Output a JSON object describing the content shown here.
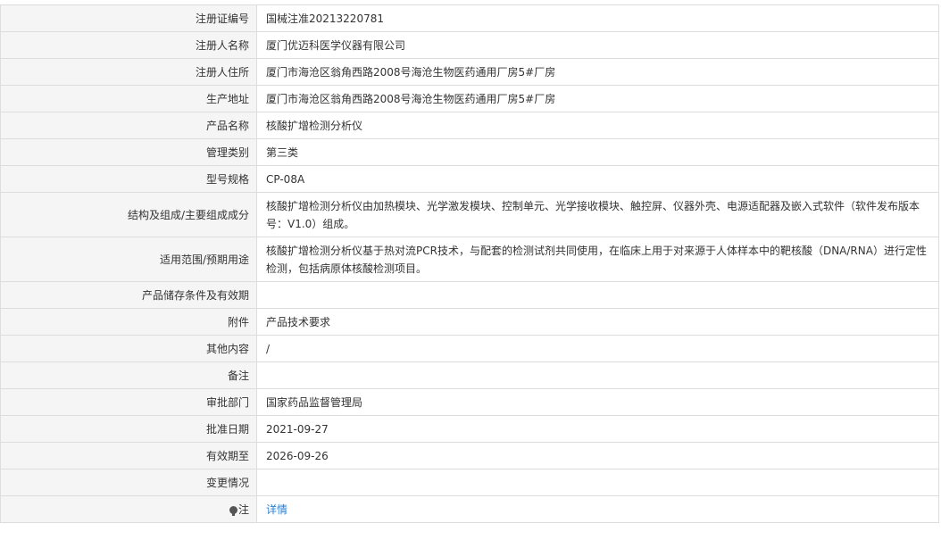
{
  "rows": [
    {
      "label": "注册证编号",
      "value": "国械注准20213220781"
    },
    {
      "label": "注册人名称",
      "value": "厦门优迈科医学仪器有限公司"
    },
    {
      "label": "注册人住所",
      "value": "厦门市海沧区翁角西路2008号海沧生物医药通用厂房5#厂房"
    },
    {
      "label": "生产地址",
      "value": "厦门市海沧区翁角西路2008号海沧生物医药通用厂房5#厂房"
    },
    {
      "label": "产品名称",
      "value": "核酸扩增检测分析仪"
    },
    {
      "label": "管理类别",
      "value": "第三类"
    },
    {
      "label": "型号规格",
      "value": "CP-08A"
    },
    {
      "label": "结构及组成/主要组成成分",
      "value": "核酸扩增检测分析仪由加热模块、光学激发模块、控制单元、光学接收模块、触控屏、仪器外壳、电源适配器及嵌入式软件（软件发布版本号：V1.0）组成。"
    },
    {
      "label": "适用范围/预期用途",
      "value": "核酸扩增检测分析仪基于热对流PCR技术，与配套的检测试剂共同使用，在临床上用于对来源于人体样本中的靶核酸（DNA/RNA）进行定性检测，包括病原体核酸检测项目。"
    },
    {
      "label": "产品储存条件及有效期",
      "value": ""
    },
    {
      "label": "附件",
      "value": "产品技术要求"
    },
    {
      "label": "其他内容",
      "value": "/"
    },
    {
      "label": "备注",
      "value": ""
    },
    {
      "label": "审批部门",
      "value": "国家药品监督管理局"
    },
    {
      "label": "批准日期",
      "value": "2021-09-27"
    },
    {
      "label": "有效期至",
      "value": "2026-09-26"
    },
    {
      "label": "变更情况",
      "value": ""
    }
  ],
  "note": {
    "label": "注",
    "icon": "lightbulb-icon",
    "link_text": "详情",
    "link_color": "#2a7fd4"
  }
}
